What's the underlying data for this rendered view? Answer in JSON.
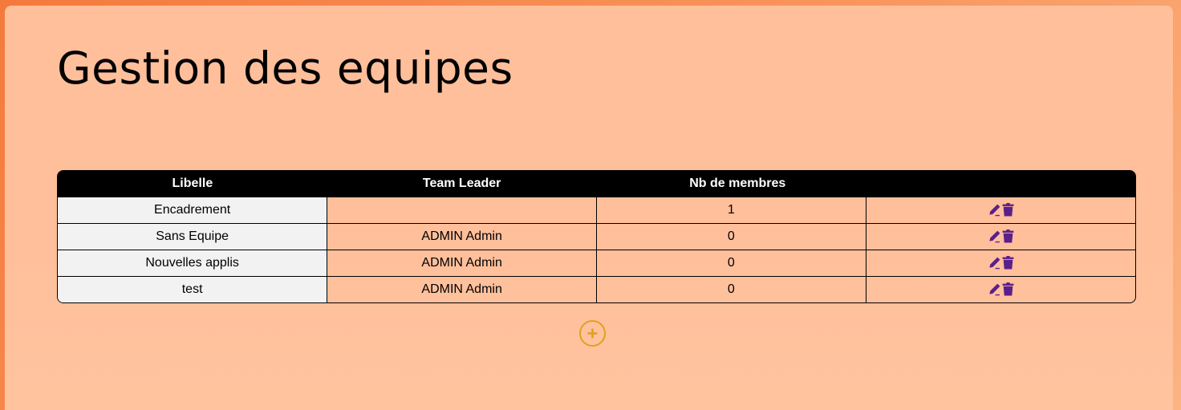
{
  "page": {
    "title": "Gestion des equipes"
  },
  "table": {
    "headers": {
      "libelle": "Libelle",
      "team_leader": "Team Leader",
      "nb_membres": "Nb de membres",
      "actions": ""
    },
    "rows": [
      {
        "libelle": "Encadrement",
        "team_leader": "",
        "nb_membres": "1"
      },
      {
        "libelle": "Sans Equipe",
        "team_leader": "ADMIN Admin",
        "nb_membres": "0"
      },
      {
        "libelle": "Nouvelles applis",
        "team_leader": "ADMIN Admin",
        "nb_membres": "0"
      },
      {
        "libelle": "test",
        "team_leader": "ADMIN Admin",
        "nb_membres": "0"
      }
    ],
    "row_actions": [
      {
        "icon": "pencil-icon",
        "color": "#5b1f8a"
      },
      {
        "icon": "trash-icon",
        "color": "#5b1f8a"
      }
    ]
  },
  "add_button": {
    "icon": "plus-icon",
    "color": "#e0a020"
  },
  "colors": {
    "background_outer": "#f47a3c",
    "card_background": "#ffbf9b",
    "header_background": "#000000",
    "first_column_background": "#f2f2f2",
    "action_icon_color": "#5b1f8a",
    "add_button_color": "#e0a020"
  }
}
